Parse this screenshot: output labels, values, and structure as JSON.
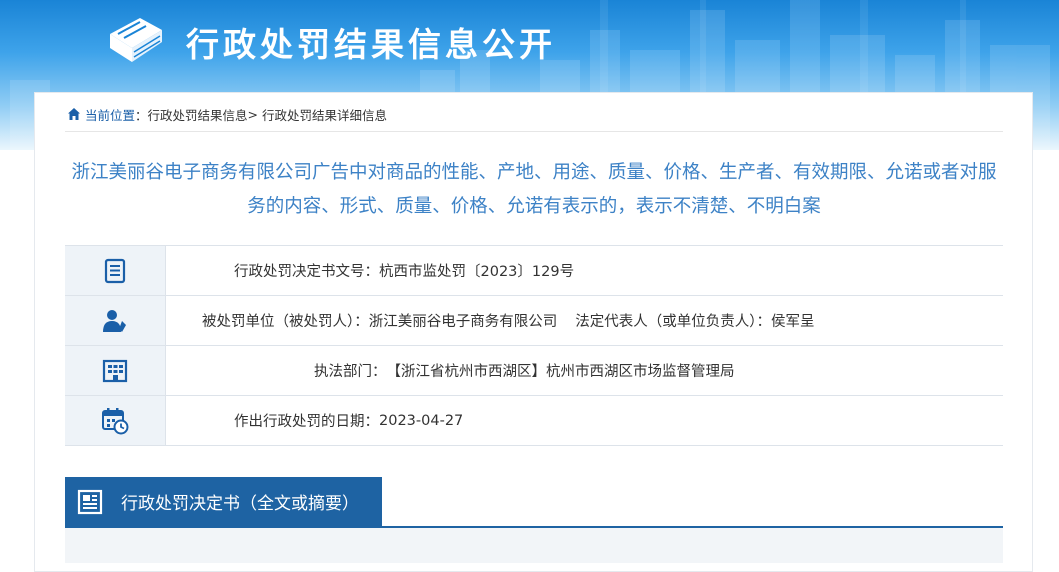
{
  "header": {
    "title": "行政处罚结果信息公开"
  },
  "breadcrumb": {
    "current_label": "当前位置",
    "separator1": "：",
    "link_list": "行政处罚结果信息",
    "separator2": ">",
    "link_detail": "行政处罚结果详细信息"
  },
  "case": {
    "title": "浙江美丽谷电子商务有限公司广告中对商品的性能、产地、用途、质量、价格、生产者、有效期限、允诺或者对服务的内容、形式、质量、价格、允诺有表示的，表示不清楚、不明白案",
    "decision_no_label": "行政处罚决定书文号：",
    "decision_no": "杭西市监处罚〔2023〕129号",
    "party_label": "被处罚单位（被处罚人）：",
    "party": "浙江美丽谷电子商务有限公司",
    "rep_label": "法定代表人（或单位负责人）：",
    "rep": "侯军呈",
    "dept_label": "执法部门：",
    "dept": "【浙江省杭州市西湖区】杭州市西湖区市场监督管理局",
    "date_label": "作出行政处罚的日期：",
    "date": "2023-04-27"
  },
  "section": {
    "tab_label": "行政处罚决定书（全文或摘要）"
  },
  "icons": {
    "logo": "book-icon",
    "home": "home-icon",
    "doc": "document-list-icon",
    "person": "person-icon",
    "building": "building-icon",
    "calendar": "calendar-clock-icon",
    "tab": "document-icon"
  },
  "colors": {
    "title": "#3d82c6",
    "tab_bg": "#1e63a3",
    "icon": "#1a5fa8"
  }
}
